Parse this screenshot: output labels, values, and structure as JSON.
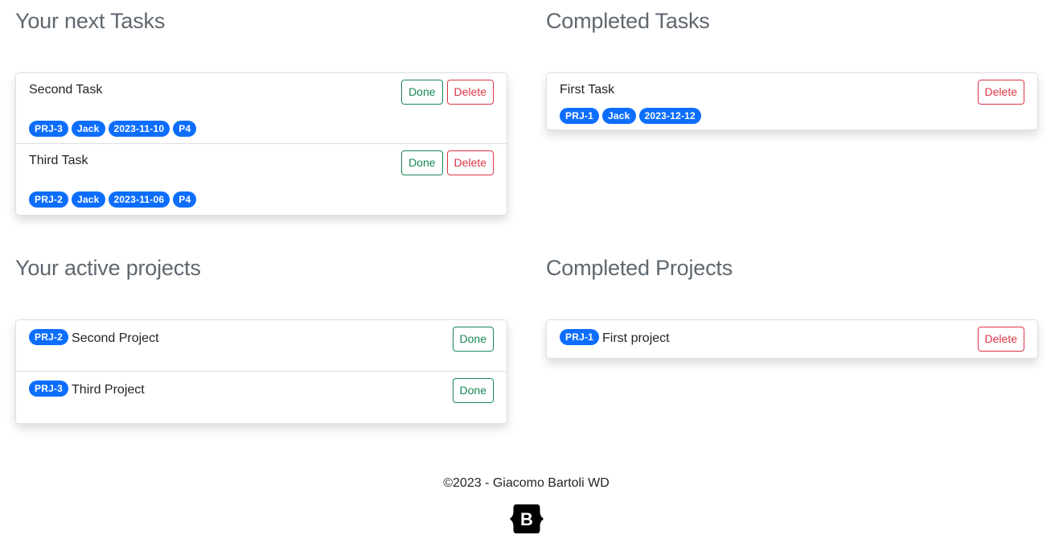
{
  "next_tasks": {
    "heading": "Your next Tasks",
    "items": [
      {
        "title": "Second Task",
        "badges": [
          "PRJ-3",
          "Jack",
          "2023-11-10",
          "P4"
        ],
        "done_label": "Done",
        "delete_label": "Delete"
      },
      {
        "title": "Third Task",
        "badges": [
          "PRJ-2",
          "Jack",
          "2023-11-06",
          "P4"
        ],
        "done_label": "Done",
        "delete_label": "Delete"
      }
    ]
  },
  "completed_tasks": {
    "heading": "Completed Tasks",
    "items": [
      {
        "title": "First Task",
        "badges": [
          "PRJ-1",
          "Jack",
          "2023-12-12"
        ],
        "delete_label": "Delete"
      }
    ]
  },
  "active_projects": {
    "heading": "Your active projects",
    "items": [
      {
        "badge": "PRJ-2",
        "title": "Second Project",
        "done_label": "Done"
      },
      {
        "badge": "PRJ-3",
        "title": "Third Project",
        "done_label": "Done"
      }
    ]
  },
  "completed_projects": {
    "heading": "Completed Projects",
    "items": [
      {
        "badge": "PRJ-1",
        "title": "First project",
        "delete_label": "Delete"
      }
    ]
  },
  "footer": {
    "copyright": "©2023 - Giacomo Bartoli WD",
    "logo_icon": "bootstrap-logo-icon",
    "logo_letter": "B"
  },
  "colors": {
    "badge": "#0d6efd",
    "done": "#198754",
    "delete": "#dc3545",
    "heading": "#5f676f"
  }
}
